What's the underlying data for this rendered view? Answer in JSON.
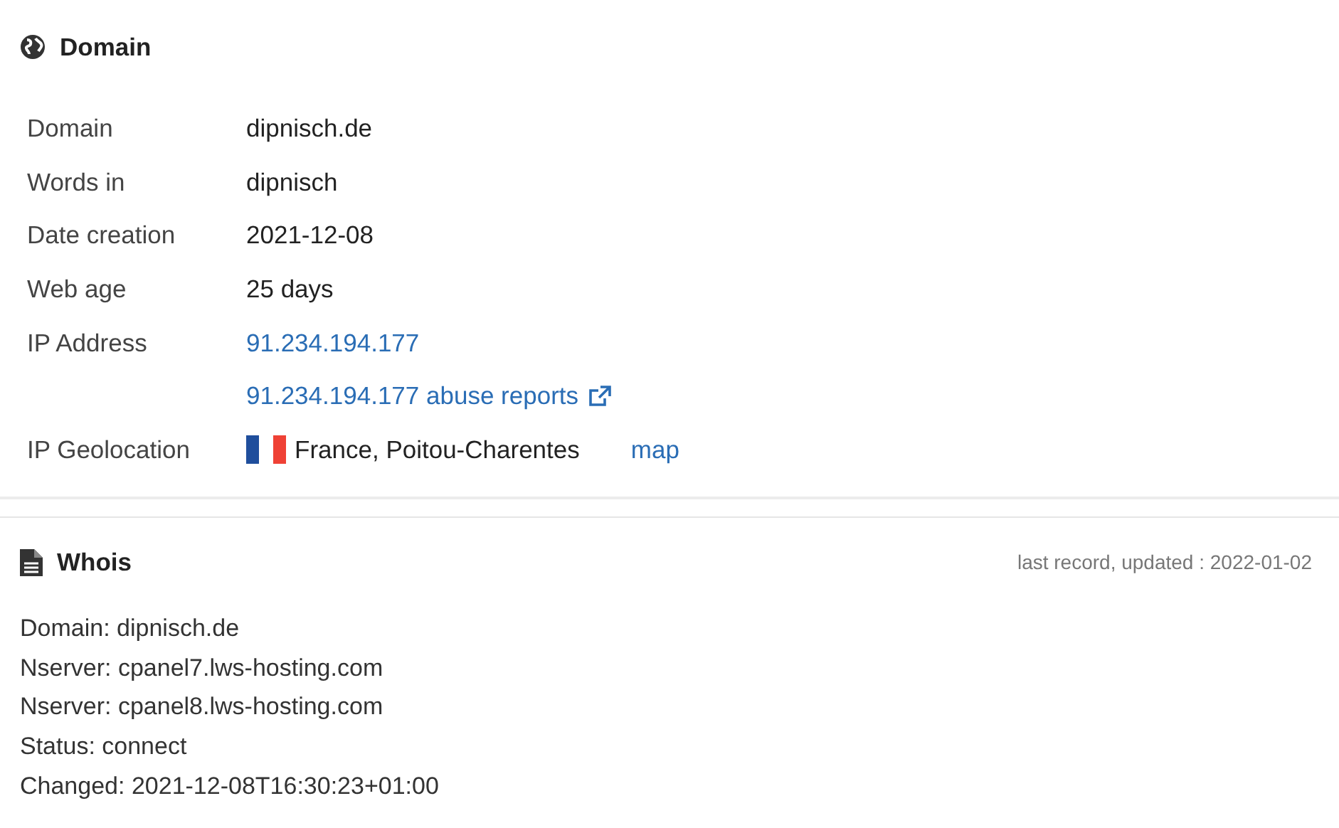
{
  "domain_section": {
    "title": "Domain",
    "rows": [
      {
        "label": "Domain",
        "kind": "text",
        "value": "dipnisch.de"
      },
      {
        "label": "Words in",
        "kind": "text",
        "value": "dipnisch"
      },
      {
        "label": "Date creation",
        "kind": "text",
        "value": "2021-12-08"
      },
      {
        "label": "Web age",
        "kind": "text",
        "value": "25 days"
      },
      {
        "label": "IP Address",
        "kind": "link",
        "value": "91.234.194.177"
      },
      {
        "kind": "external-link",
        "value": "91.234.194.177 abuse reports"
      },
      {
        "label": "IP Geolocation",
        "kind": "geo",
        "value": "France, Poitou-Charentes",
        "link": "map"
      }
    ]
  },
  "whois_section": {
    "title": "Whois",
    "updated": "last record, updated : 2022-01-02",
    "lines": [
      "Domain: dipnisch.de",
      "Nserver: cpanel7.lws-hosting.com",
      "Nserver: cpanel8.lws-hosting.com",
      "Status: connect",
      "Changed: 2021-12-08T16:30:23+01:00"
    ]
  }
}
